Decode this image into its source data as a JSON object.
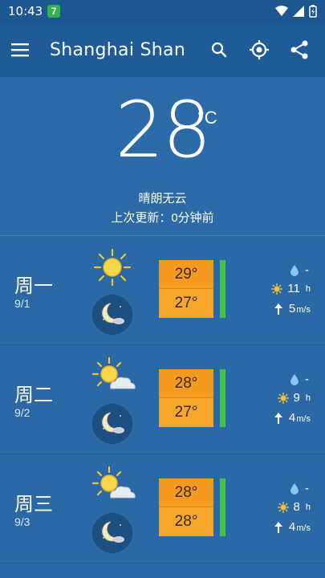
{
  "status": {
    "time": "10:43",
    "notif": "7"
  },
  "appbar": {
    "title": "Shanghai Shan"
  },
  "current": {
    "temp": "28",
    "unit": "°C",
    "description": "晴朗无云",
    "updated": "上次更新：0分钟前"
  },
  "days": [
    {
      "name": "周一",
      "date": "9/1",
      "hi": "29°",
      "lo": "27°",
      "rain": "-",
      "sun": "11",
      "sun_unit": "h",
      "wind": "5",
      "wind_unit": "m/s",
      "icon": "sun-icon"
    },
    {
      "name": "周二",
      "date": "9/2",
      "hi": "28°",
      "lo": "27°",
      "rain": "-",
      "sun": "9",
      "sun_unit": "h",
      "wind": "4",
      "wind_unit": "m/s",
      "icon": "sun-cloud-icon"
    },
    {
      "name": "周三",
      "date": "9/3",
      "hi": "28°",
      "lo": "28°",
      "rain": "-",
      "sun": "8",
      "sun_unit": "h",
      "wind": "4",
      "wind_unit": "m/s",
      "icon": "sun-cloud-icon"
    }
  ],
  "colors": {
    "background": "#2a68a6",
    "appbar": "#1f5b96",
    "hi_temp": "#f39a1f",
    "lo_temp": "#f5a72b",
    "bar": "#46c24a"
  }
}
